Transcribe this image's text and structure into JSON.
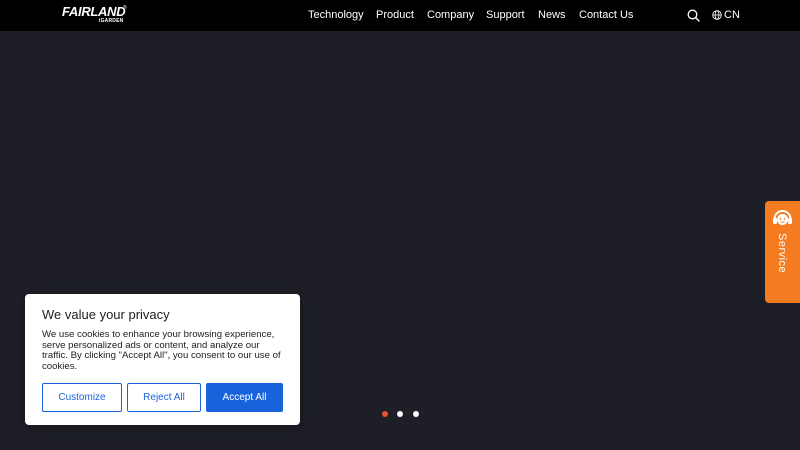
{
  "header": {
    "logo": {
      "main": "FAIRLAND",
      "sub": "iGARDEN",
      "reg": "®"
    },
    "nav": [
      "Technology",
      "Product",
      "Company",
      "Support",
      "News",
      "Contact Us"
    ],
    "search_icon": "search-icon",
    "language": {
      "icon": "globe-icon",
      "label": "CN"
    }
  },
  "service_tab": {
    "label": "Service",
    "icon": "headset-icon"
  },
  "carousel": {
    "slide_count": 3,
    "active_index": 0,
    "active_color": "#e8502e",
    "inactive_color": "#ffffff"
  },
  "cookie_banner": {
    "title": "We value your privacy",
    "text": "We use cookies to enhance your browsing experience, serve personalized ads or content, and analyze our traffic. By clicking \"Accept All\", you consent to our use of cookies.",
    "buttons": {
      "customize": "Customize",
      "reject": "Reject All",
      "accept": "Accept All"
    }
  },
  "colors": {
    "header_bg": "#000000",
    "hero_bg": "#1d1e26",
    "service_bg": "#f47b20",
    "cookie_accent": "#1863dc"
  }
}
